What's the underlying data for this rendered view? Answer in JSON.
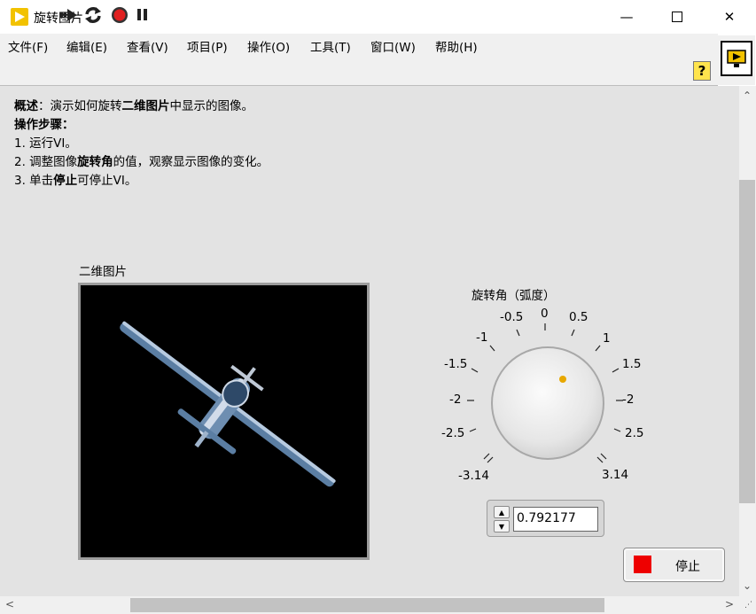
{
  "window": {
    "title": "旋转图片"
  },
  "menu": [
    "文件(F)",
    "编辑(E)",
    "查看(V)",
    "项目(P)",
    "操作(O)",
    "工具(T)",
    "窗口(W)",
    "帮助(H)"
  ],
  "toolbar": {
    "help_label": "?"
  },
  "description": {
    "line1_prefix": "概述",
    "line1_a": "：演示如何旋转",
    "line1_b": "二维图片",
    "line1_c": "中显示的图像。",
    "line2": "操作步骤：",
    "line3": "1. 运行VI。",
    "line4_a": "2. 调整图像",
    "line4_b": "旋转角",
    "line4_c": "的值，观察显示图像的变化。",
    "line5_a": "3. 单击",
    "line5_b": "停止",
    "line5_c": "可停止VI。"
  },
  "picture": {
    "label": "二维图片"
  },
  "knob": {
    "label": "旋转角（弧度）",
    "ticks": [
      "-3.14",
      "-2.5",
      "-2",
      "-1.5",
      "-1",
      "-0.5",
      "0",
      "0.5",
      "1",
      "1.5",
      "-2",
      "2.5",
      "3.14"
    ],
    "value": "0.792177",
    "indicator_color": "#e8a800"
  },
  "stop_button": {
    "label": "停止",
    "led_color": "#ee0000"
  }
}
